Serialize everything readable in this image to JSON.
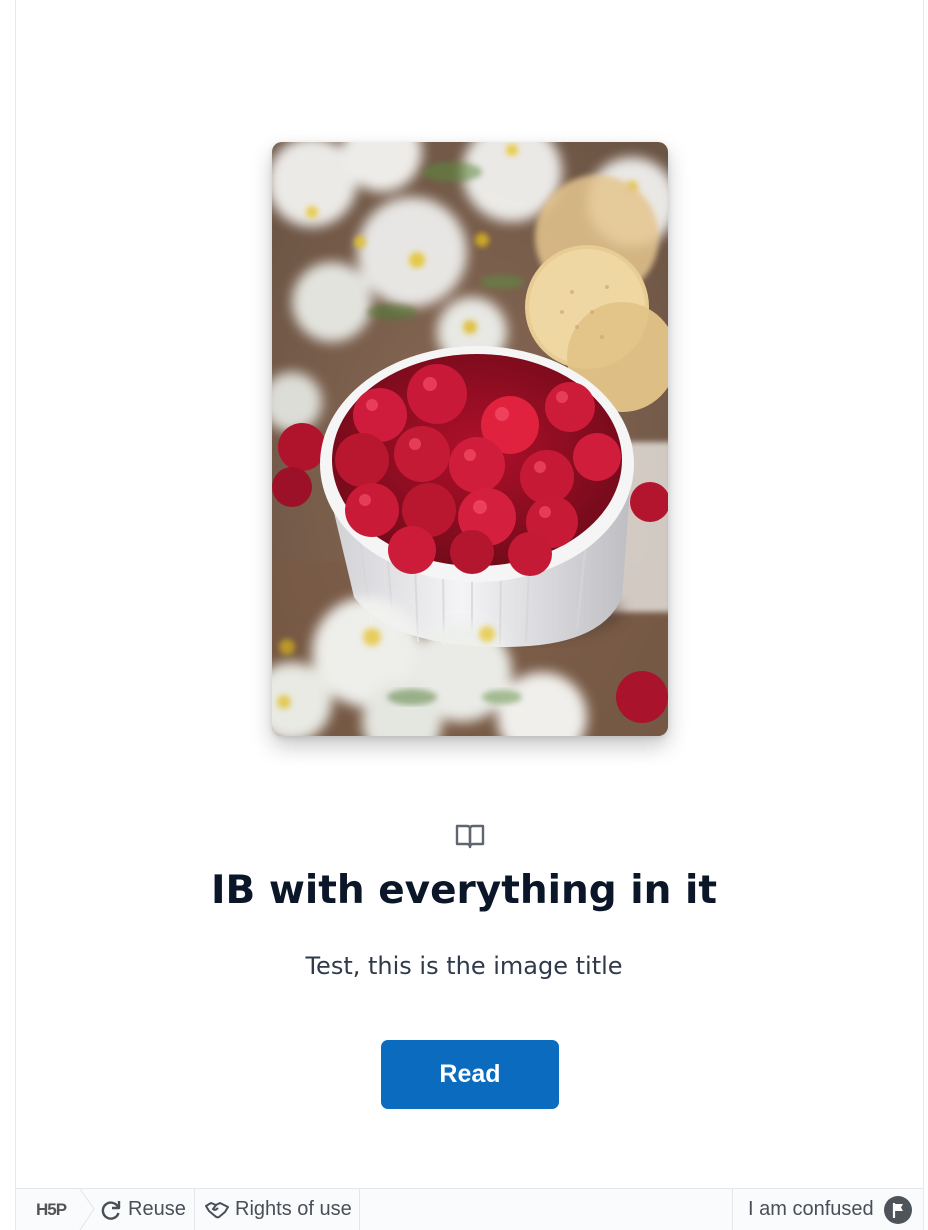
{
  "book": {
    "title": "IB with everything in it",
    "subtitle": "Test, this is the image title",
    "read_label": "Read",
    "cover_image": "raspberries-in-white-bowl-with-daisies-and-cookies"
  },
  "footer": {
    "logo_text": "H5P",
    "reuse_label": "Reuse",
    "rights_label": "Rights of use",
    "confused_label": "I am confused"
  },
  "colors": {
    "title": "#0b1628",
    "button_bg": "#0a6bbf",
    "button_text": "#ffffff"
  }
}
